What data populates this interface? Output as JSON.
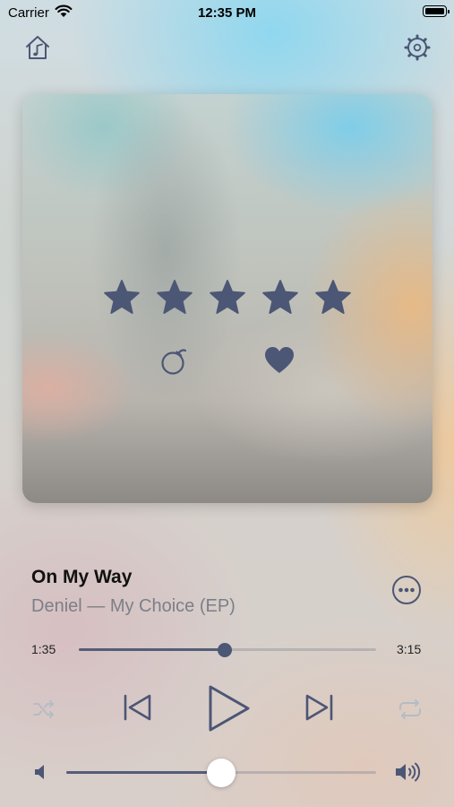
{
  "status_bar": {
    "carrier": "Carrier",
    "time": "12:35 PM"
  },
  "header": {
    "left_icon": "home-music-icon",
    "right_icon": "settings-icon"
  },
  "artwork": {
    "rating": 5,
    "max_rating": 5,
    "bomb_icon": "bomb-icon",
    "heart_icon": "heart-icon"
  },
  "track": {
    "title": "On My Way",
    "subtitle": "Deniel — My Choice (EP)"
  },
  "progress": {
    "elapsed": "1:35",
    "total": "3:15",
    "fraction": 0.49
  },
  "controls": {
    "shuffle_icon": "shuffle-icon",
    "previous_icon": "previous-icon",
    "play_icon": "play-icon",
    "next_icon": "next-icon",
    "repeat_icon": "repeat-icon"
  },
  "volume": {
    "fraction": 0.5
  },
  "colors": {
    "accent": "#4c5675",
    "secondary_text": "#7b7f88",
    "disabled": "#b5bcc4"
  }
}
